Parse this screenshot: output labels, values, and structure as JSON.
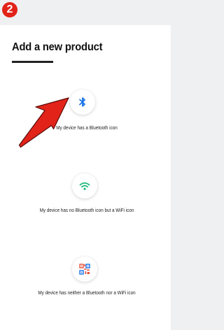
{
  "step_badge": "2",
  "page_title": "Add a new product",
  "options": [
    {
      "label": "My device has a Bluetooth icon",
      "icon": "bluetooth-icon"
    },
    {
      "label": "My device has no Bluetooth icon but a WiFi icon",
      "icon": "wifi-icon"
    },
    {
      "label": "My device has neither a Bluetooth nor a WiFi icon",
      "icon": "qr-code-icon"
    }
  ],
  "colors": {
    "badge": "#e2231a",
    "arrow": "#e2231a",
    "bluetooth": "#1a73e8",
    "wifi": "#1db97a",
    "qr_primary": "#e5533d",
    "qr_secondary": "#1a73e8",
    "background": "#eef0f2",
    "card": "#ffffff"
  }
}
